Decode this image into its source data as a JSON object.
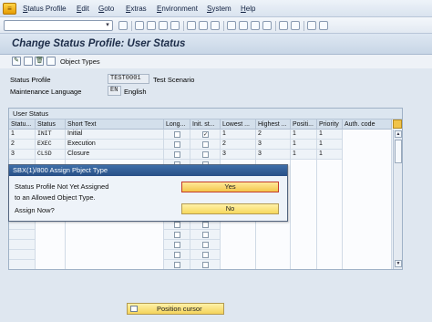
{
  "menubar": {
    "items": [
      "Status Profile",
      "Edit",
      "Goto",
      "Extras",
      "Environment",
      "System",
      "Help"
    ]
  },
  "page": {
    "title": "Change Status Profile: User Status"
  },
  "app_toolbar": {
    "object_types_label": "Object Types"
  },
  "header_fields": {
    "status_profile_label": "Status Profile",
    "status_profile_value": "TEST0001",
    "status_profile_desc": "Test Scenario",
    "maint_lang_label": "Maintenance Language",
    "maint_lang_value": "EN",
    "maint_lang_desc": "English"
  },
  "table": {
    "title": "User Status",
    "columns": [
      "Statu...",
      "Status",
      "Short Text",
      "Long...",
      "Init. st...",
      "Lowest ...",
      "Highest ...",
      "Positi...",
      "Priority",
      "Auth. code"
    ],
    "rows": [
      {
        "num": "1",
        "status": "INIT",
        "text": "Initial",
        "long": false,
        "init": true,
        "lowest": "1",
        "highest": "2",
        "pos": "1",
        "prio": "1",
        "auth": ""
      },
      {
        "num": "2",
        "status": "EXEC",
        "text": "Execution",
        "long": false,
        "init": false,
        "lowest": "2",
        "highest": "3",
        "pos": "1",
        "prio": "1",
        "auth": ""
      },
      {
        "num": "3",
        "status": "CLSD",
        "text": "Closure",
        "long": false,
        "init": false,
        "lowest": "3",
        "highest": "3",
        "pos": "1",
        "prio": "1",
        "auth": ""
      }
    ]
  },
  "popup": {
    "title": "SBX(1)/800 Assign Pbject Type",
    "line1": "Status Profile Not Yet Assigned",
    "line2": "to an Allowed Object Type.",
    "line3": "Assign Now?",
    "yes_label": "Yes",
    "no_label": "No"
  },
  "footer": {
    "position_cursor_label": "Position cursor"
  }
}
